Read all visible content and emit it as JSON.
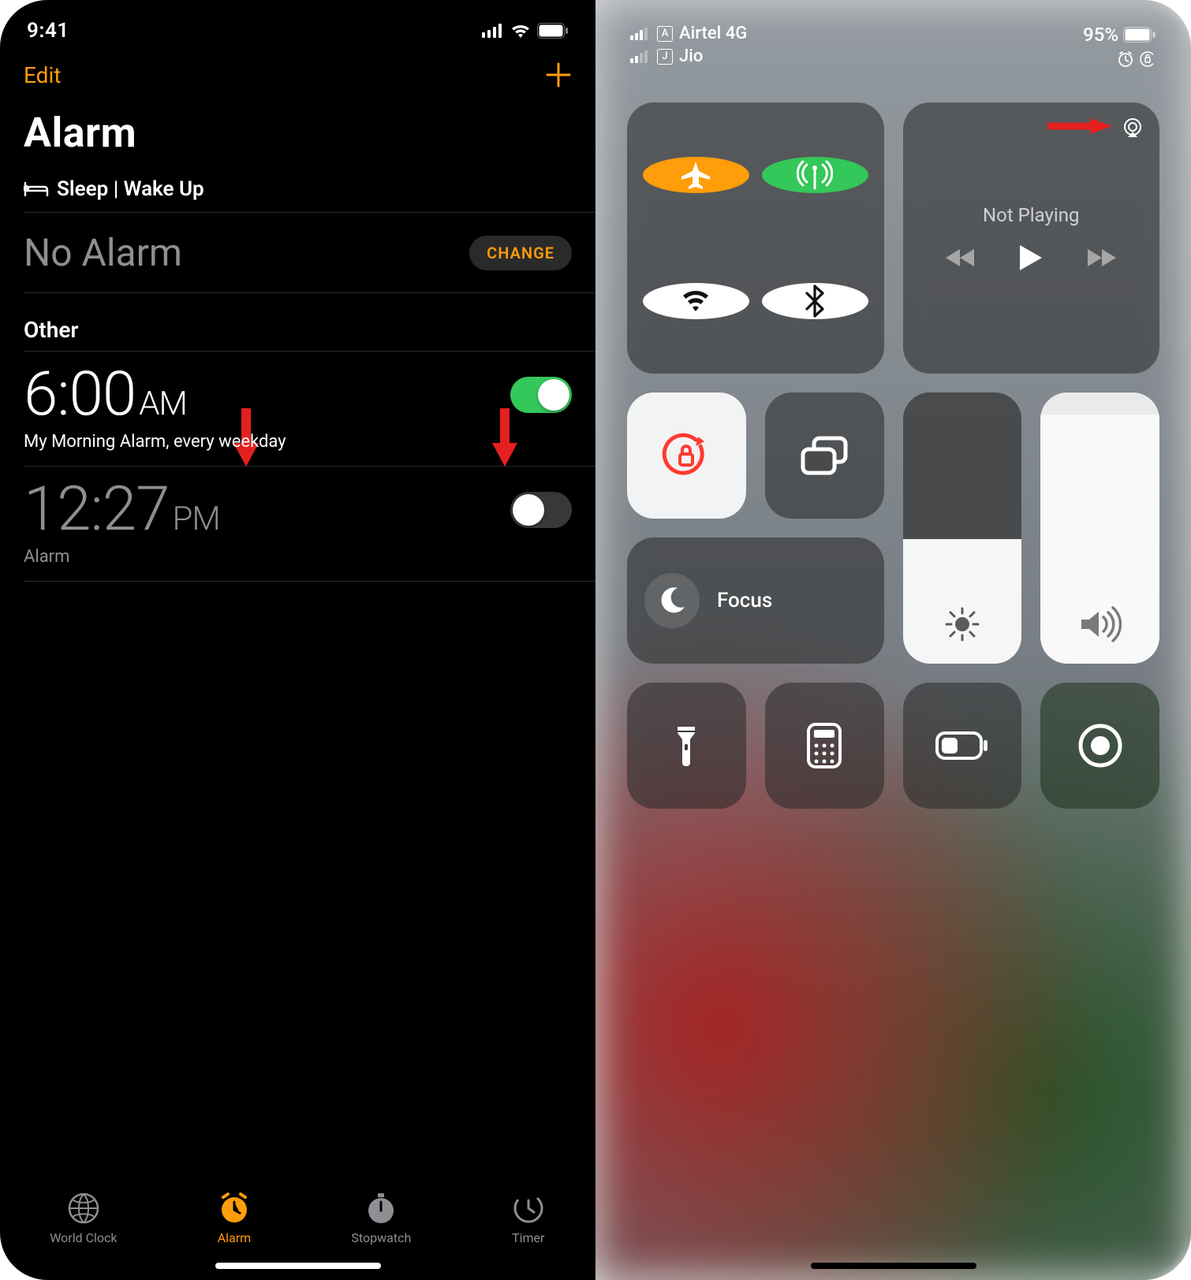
{
  "left": {
    "status": {
      "time": "9:41"
    },
    "nav": {
      "edit": "Edit"
    },
    "title": "Alarm",
    "sleep_section": {
      "header": "Sleep | Wake Up",
      "no_alarm": "No Alarm",
      "change": "CHANGE"
    },
    "other_header": "Other",
    "alarms": [
      {
        "time": "6:00",
        "meridiem": "AM",
        "label": "My Morning Alarm, every weekday",
        "on": true
      },
      {
        "time": "12:27",
        "meridiem": "PM",
        "label": "Alarm",
        "on": false
      }
    ],
    "tabs": [
      {
        "label": "World Clock",
        "icon": "globe-icon",
        "active": false
      },
      {
        "label": "Alarm",
        "icon": "alarm-icon",
        "active": true
      },
      {
        "label": "Stopwatch",
        "icon": "stopwatch-icon",
        "active": false
      },
      {
        "label": "Timer",
        "icon": "timer-icon",
        "active": false
      }
    ]
  },
  "right": {
    "status": {
      "carriers": [
        {
          "sim": "A",
          "name": "Airtel 4G"
        },
        {
          "sim": "J",
          "name": "Jio"
        }
      ],
      "battery": "95%"
    },
    "media": {
      "title": "Not Playing"
    },
    "focus": {
      "label": "Focus"
    }
  }
}
